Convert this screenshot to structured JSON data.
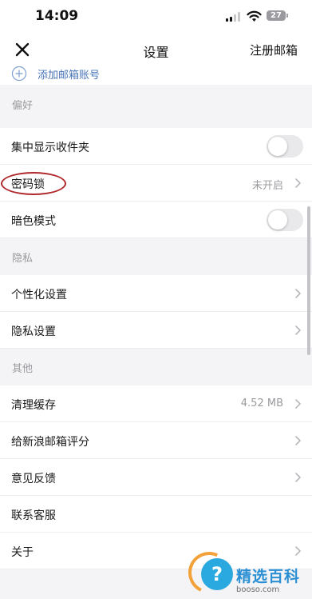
{
  "status_bar": {
    "time": "14:09",
    "battery": "27"
  },
  "nav": {
    "title": "设置",
    "register_label": "注册邮箱"
  },
  "add_account": {
    "label": "添加邮箱账号"
  },
  "sections": {
    "preferences": "偏好",
    "privacy": "隐私",
    "other": "其他"
  },
  "rows": {
    "unified_inbox": {
      "label": "集中显示收件夹",
      "toggle_on": false
    },
    "password_lock": {
      "label": "密码锁",
      "value": "未开启"
    },
    "dark_mode": {
      "label": "暗色模式",
      "toggle_on": false
    },
    "personalization": {
      "label": "个性化设置"
    },
    "privacy_settings": {
      "label": "隐私设置"
    },
    "clear_cache": {
      "label": "清理缓存",
      "value": "4.52 MB"
    },
    "rate_app": {
      "label": "给新浪邮箱评分"
    },
    "feedback": {
      "label": "意见反馈"
    },
    "contact_support": {
      "label": "联系客服"
    },
    "about": {
      "label": "关于"
    }
  },
  "watermark": {
    "title": "精选百科",
    "url": "booso.com"
  },
  "colors": {
    "accent_link": "#4a76b8",
    "annotation": "#b0282c",
    "background": "#f4f4f6"
  }
}
